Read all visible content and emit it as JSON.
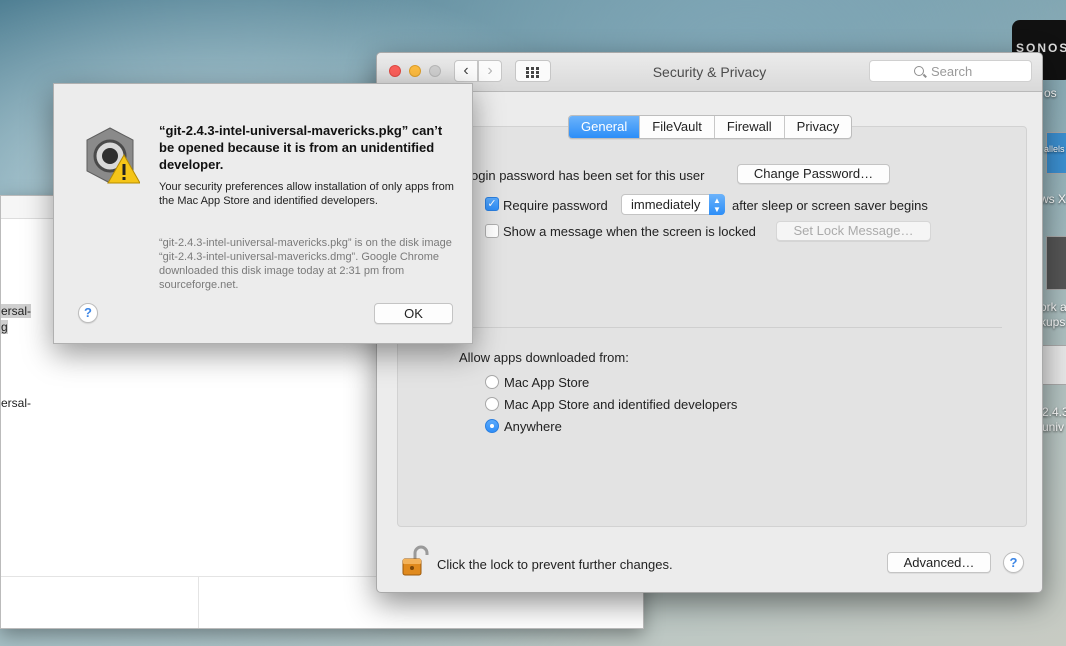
{
  "desktop": {
    "sonos_label": "SONOS",
    "frag_1": "os",
    "frag_2": "allels",
    "frag_3": "ws X",
    "frag_4": "ork a",
    "frag_5": "kups",
    "frag_6": "2.4.3",
    "frag_7": "univ"
  },
  "finder": {
    "selected_name_line1": "ersal-",
    "selected_name_line2": "g",
    "name_fragment": "ersal-"
  },
  "security_window": {
    "title": "Security & Privacy",
    "search_placeholder": "Search",
    "tabs": [
      {
        "label": "General",
        "active": true
      },
      {
        "label": "FileVault",
        "active": false
      },
      {
        "label": "Firewall",
        "active": false
      },
      {
        "label": "Privacy",
        "active": false
      }
    ],
    "login_password_text": "ogin password has been set for this user",
    "change_password_label": "Change Password…",
    "require_password_label": "Require password",
    "require_password_checked": true,
    "require_password_option": "immediately",
    "require_password_suffix": "after sleep or screen saver begins",
    "show_message_label": "Show a message when the screen is locked",
    "show_message_checked": false,
    "set_lock_message_label": "Set Lock Message…",
    "allow_apps_label": "Allow apps downloaded from:",
    "allow_apps_options": [
      {
        "label": "Mac App Store",
        "selected": false
      },
      {
        "label": "Mac App Store and identified developers",
        "selected": false
      },
      {
        "label": "Anywhere",
        "selected": true
      }
    ],
    "lock_text": "Click the lock to prevent further changes.",
    "advanced_label": "Advanced…",
    "help_label": "?"
  },
  "alert": {
    "title": "“git-2.4.3-intel-universal-mavericks.pkg” can’t be opened because it is from an unidentified developer.",
    "body": "Your security preferences allow installation of only apps from the Mac App Store and identified developers.",
    "note": "“git-2.4.3-intel-universal-mavericks.pkg” is on the disk image “git-2.4.3-intel-universal-mavericks.dmg”. Google Chrome downloaded this disk image today at 2:31 pm from sourceforge.net.",
    "ok_label": "OK",
    "help_label": "?"
  },
  "colors": {
    "accent_blue": "#2c8ef8",
    "close_red": "#fc605b",
    "minimize_yellow": "#fdbc40",
    "warning_yellow": "#f5c518"
  }
}
